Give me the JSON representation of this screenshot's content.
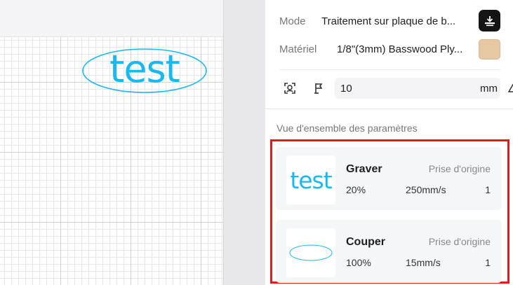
{
  "canvas": {
    "object_text": "test",
    "object_color": "#19b8f0"
  },
  "settings": {
    "mode_label": "Mode",
    "mode_value": "Traitement sur plaque de b...",
    "material_label": "Matériel",
    "material_value": "1/8\"(3mm) Basswood Ply...",
    "material_color": "#e6c9a3",
    "focus_value": "10",
    "focus_unit": "mm"
  },
  "overview": {
    "title": "Vue d'ensemble des paramètres",
    "layers": [
      {
        "thumb_text": "test",
        "name": "Graver",
        "origin": "Prise d'origine",
        "power": "20%",
        "speed": "250mm/s",
        "passes": "1"
      },
      {
        "thumb_text": "",
        "name": "Couper",
        "origin": "Prise d'origine",
        "power": "100%",
        "speed": "15mm/s",
        "passes": "1"
      }
    ]
  },
  "colors": {
    "accent": "#19b8f0",
    "highlight": "#e01b1b"
  }
}
